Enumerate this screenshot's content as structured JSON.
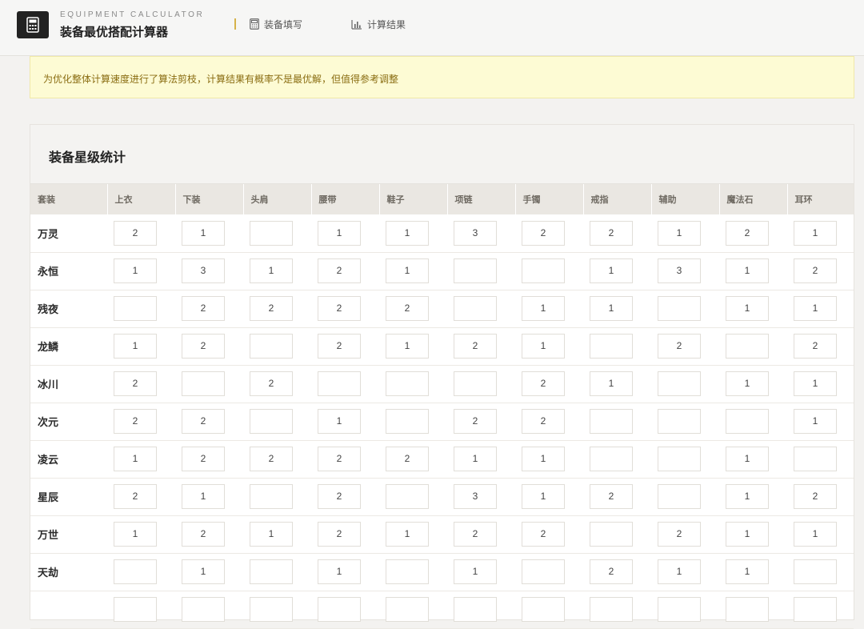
{
  "header": {
    "brand_sub": "EQUIPMENT CALCULATOR",
    "brand_title": "装备最优搭配计算器",
    "nav": [
      {
        "label": "装备填写",
        "icon": "calculator-icon"
      },
      {
        "label": "计算结果",
        "icon": "bar-chart-icon"
      }
    ]
  },
  "notice": {
    "text": "为优化整体计算速度进行了算法剪枝，计算结果有概率不是最优解，但值得参考调整"
  },
  "stats": {
    "title": "装备星级统计",
    "columns": [
      "套装",
      "上衣",
      "下装",
      "头肩",
      "腰带",
      "鞋子",
      "项链",
      "手镯",
      "戒指",
      "辅助",
      "魔法石",
      "耳环"
    ],
    "rows": [
      {
        "name": "万灵",
        "values": [
          "2",
          "1",
          "",
          "1",
          "1",
          "3",
          "2",
          "2",
          "1",
          "2",
          "1"
        ]
      },
      {
        "name": "永恒",
        "values": [
          "1",
          "3",
          "1",
          "2",
          "1",
          "",
          "",
          "1",
          "3",
          "1",
          "2"
        ]
      },
      {
        "name": "残夜",
        "values": [
          "",
          "2",
          "2",
          "2",
          "2",
          "",
          "1",
          "1",
          "",
          "1",
          "1"
        ]
      },
      {
        "name": "龙鳞",
        "values": [
          "1",
          "2",
          "",
          "2",
          "1",
          "2",
          "1",
          "",
          "2",
          "",
          "2"
        ]
      },
      {
        "name": "冰川",
        "values": [
          "2",
          "",
          "2",
          "",
          "",
          "",
          "2",
          "1",
          "",
          "1",
          "1"
        ]
      },
      {
        "name": "次元",
        "values": [
          "2",
          "2",
          "",
          "1",
          "",
          "2",
          "2",
          "",
          "",
          "",
          "1"
        ]
      },
      {
        "name": "凌云",
        "values": [
          "1",
          "2",
          "2",
          "2",
          "2",
          "1",
          "1",
          "",
          "",
          "1",
          ""
        ]
      },
      {
        "name": "星辰",
        "values": [
          "2",
          "1",
          "",
          "2",
          "",
          "3",
          "1",
          "2",
          "",
          "1",
          "2"
        ]
      },
      {
        "name": "万世",
        "values": [
          "1",
          "2",
          "1",
          "2",
          "1",
          "2",
          "2",
          "",
          "2",
          "1",
          "1"
        ]
      },
      {
        "name": "天劫",
        "values": [
          "",
          "1",
          "",
          "1",
          "",
          "1",
          "",
          "2",
          "1",
          "1",
          ""
        ]
      },
      {
        "name": "",
        "values": [
          "",
          "",
          "",
          "",
          "",
          "",
          "",
          "",
          "",
          "",
          ""
        ]
      }
    ]
  },
  "colors": {
    "accent": "#d6b24a",
    "notice_bg": "#fdfbd4",
    "notice_text": "#8a6d12",
    "header_dark": "#222222"
  }
}
